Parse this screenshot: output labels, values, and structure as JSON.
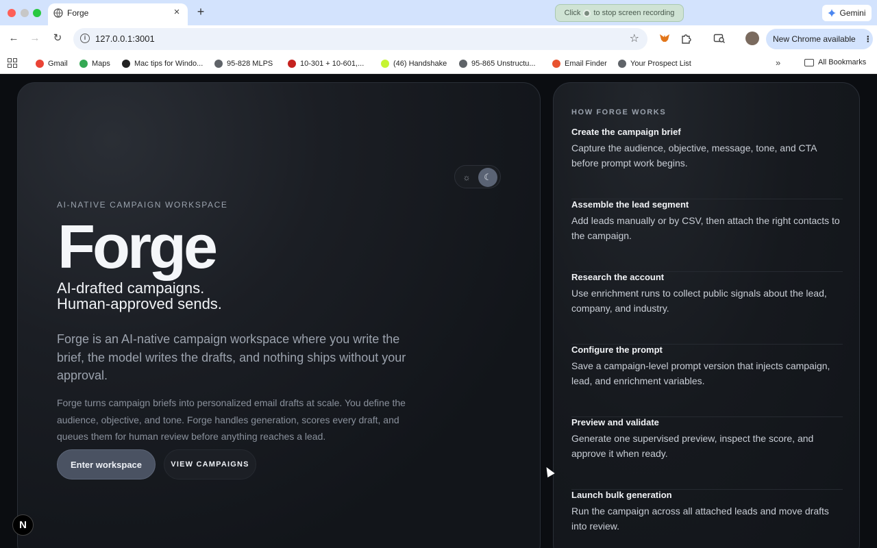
{
  "browser": {
    "tab_title": "Forge",
    "new_tab_symbol": "+",
    "tab_close_symbol": "×",
    "recording_hint_prefix": "Click",
    "recording_hint_suffix": "to stop screen recording",
    "gemini_label": "Gemini",
    "url": "127.0.0.1:3001",
    "new_chrome_label": "New Chrome available",
    "bookmarks": [
      {
        "label": "Gmail",
        "color": "#ea4335"
      },
      {
        "label": "Maps",
        "color": "#34a853"
      },
      {
        "label": "Mac tips for Windo...",
        "color": "#222222"
      },
      {
        "label": "95-828 MLPS",
        "color": "#5f6368"
      },
      {
        "label": "10-301 + 10-601,...",
        "color": "#c5221f"
      },
      {
        "label": "(46) Handshake",
        "color": "#c6f432"
      },
      {
        "label": "95-865 Unstructu...",
        "color": "#5f6368"
      },
      {
        "label": "Email Finder",
        "color": "#e8532f"
      },
      {
        "label": "Your Prospect List",
        "color": "#5f6368"
      }
    ],
    "all_bookmarks_label": "All Bookmarks"
  },
  "hero": {
    "eyebrow": "AI-NATIVE CAMPAIGN WORKSPACE",
    "brand": "Forge",
    "tagline_line1": "AI-drafted campaigns.",
    "tagline_line2": "Human-approved sends.",
    "lead": "Forge is an AI-native campaign workspace where you write the brief, the model writes the drafts, and nothing ships without your approval.",
    "body": "Forge turns campaign briefs into personalized email drafts at scale. You define the audience, objective, and tone. Forge handles generation, scores every draft, and queues them for human review before anything reaches a lead.",
    "primary_button": "Enter workspace",
    "secondary_button": "VIEW CAMPAIGNS",
    "theme_mode": "dark"
  },
  "how": {
    "title": "HOW FORGE WORKS",
    "steps": [
      {
        "title": "Create the campaign brief",
        "desc": "Capture the audience, objective, message, tone, and CTA before prompt work begins."
      },
      {
        "title": "Assemble the lead segment",
        "desc": "Add leads manually or by CSV, then attach the right contacts to the campaign."
      },
      {
        "title": "Research the account",
        "desc": "Use enrichment runs to collect public signals about the lead, company, and industry."
      },
      {
        "title": "Configure the prompt",
        "desc": "Save a campaign-level prompt version that injects campaign, lead, and enrichment variables."
      },
      {
        "title": "Preview and validate",
        "desc": "Generate one supervised preview, inspect the score, and approve it when ready."
      },
      {
        "title": "Launch bulk generation",
        "desc": "Run the campaign across all attached leads and move drafts into review."
      }
    ]
  },
  "dev_badge": "N"
}
